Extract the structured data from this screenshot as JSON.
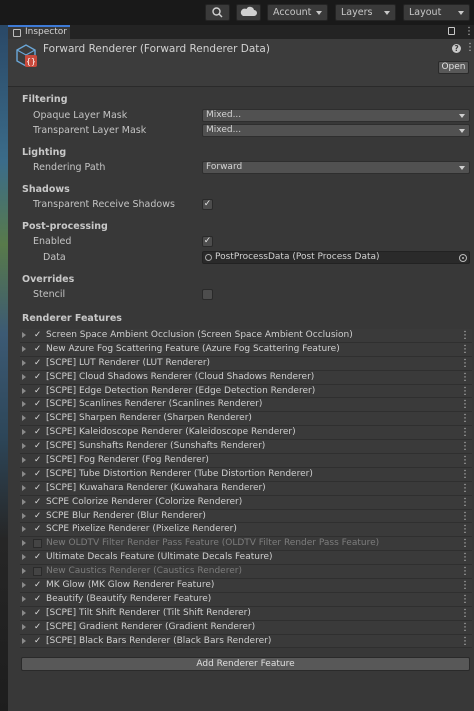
{
  "toolbar": {
    "account": "Account",
    "layers": "Layers",
    "layout": "Layout",
    "search_icon": "search-icon",
    "cloud_icon": "cloud-icon"
  },
  "tab": {
    "label": "Inspector"
  },
  "header": {
    "title": "Forward Renderer (Forward Renderer Data)",
    "open_label": "Open",
    "help": "?"
  },
  "filtering": {
    "title": "Filtering",
    "opaque_label": "Opaque Layer Mask",
    "opaque_value": "Mixed...",
    "transparent_label": "Transparent Layer Mask",
    "transparent_value": "Mixed..."
  },
  "lighting": {
    "title": "Lighting",
    "path_label": "Rendering Path",
    "path_value": "Forward"
  },
  "shadows": {
    "title": "Shadows",
    "receive_label": "Transparent Receive Shadows",
    "receive_checked": true
  },
  "postprocessing": {
    "title": "Post-processing",
    "enabled_label": "Enabled",
    "enabled_checked": true,
    "data_label": "Data",
    "data_value": "PostProcessData (Post Process Data)"
  },
  "overrides": {
    "title": "Overrides",
    "stencil_label": "Stencil",
    "stencil_checked": false
  },
  "renderer_features": {
    "title": "Renderer Features",
    "add_button": "Add Renderer Feature",
    "items": [
      {
        "name": "Screen Space Ambient Occlusion (Screen Space Ambient Occlusion)",
        "enabled": true
      },
      {
        "name": "New Azure Fog Scattering Feature (Azure Fog Scattering Feature)",
        "enabled": true
      },
      {
        "name": "[SCPE] LUT Renderer (LUT Renderer)",
        "enabled": true
      },
      {
        "name": "[SCPE] Cloud Shadows Renderer (Cloud Shadows Renderer)",
        "enabled": true
      },
      {
        "name": "[SCPE] Edge Detection Renderer (Edge Detection Renderer)",
        "enabled": true
      },
      {
        "name": "[SCPE] Scanlines Renderer (Scanlines Renderer)",
        "enabled": true
      },
      {
        "name": "[SCPE] Sharpen Renderer (Sharpen Renderer)",
        "enabled": true
      },
      {
        "name": "[SCPE] Kaleidoscope Renderer (Kaleidoscope Renderer)",
        "enabled": true
      },
      {
        "name": "[SCPE] Sunshafts Renderer (Sunshafts Renderer)",
        "enabled": true
      },
      {
        "name": "[SCPE] Fog Renderer (Fog Renderer)",
        "enabled": true
      },
      {
        "name": "[SCPE] Tube Distortion Renderer (Tube Distortion Renderer)",
        "enabled": true
      },
      {
        "name": "[SCPE] Kuwahara Renderer (Kuwahara Renderer)",
        "enabled": true
      },
      {
        "name": "SCPE Colorize Renderer (Colorize Renderer)",
        "enabled": true
      },
      {
        "name": "SCPE Blur Renderer (Blur Renderer)",
        "enabled": true
      },
      {
        "name": "SCPE Pixelize Renderer (Pixelize Renderer)",
        "enabled": true
      },
      {
        "name": "New OLDTV Filter Render Pass Feature (OLDTV Filter Render Pass Feature)",
        "enabled": false
      },
      {
        "name": "Ultimate Decals Feature (Ultimate Decals Feature)",
        "enabled": true
      },
      {
        "name": "New Caustics Renderer (Caustics Renderer)",
        "enabled": false
      },
      {
        "name": "MK Glow (MK Glow Renderer Feature)",
        "enabled": true
      },
      {
        "name": "Beautify (Beautify Renderer Feature)",
        "enabled": true
      },
      {
        "name": "[SCPE] Tilt Shift Renderer (Tilt Shift Renderer)",
        "enabled": true
      },
      {
        "name": "[SCPE] Gradient Renderer (Gradient Renderer)",
        "enabled": true
      },
      {
        "name": "[SCPE] Black Bars Renderer (Black Bars Renderer)",
        "enabled": true
      }
    ]
  },
  "colors": {
    "panel": "#383838",
    "accent": "#3d7ad6"
  }
}
